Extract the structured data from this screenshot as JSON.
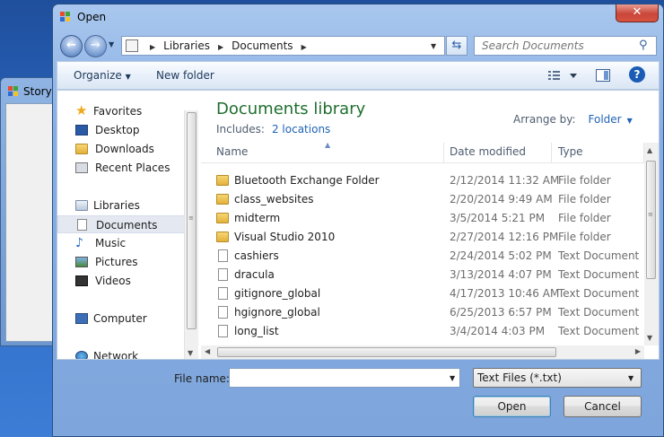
{
  "background_window": {
    "title": "Story"
  },
  "dialog": {
    "title": "Open",
    "close_glyph": "✕"
  },
  "address": {
    "crumbs": [
      "Libraries",
      "Documents"
    ],
    "search_placeholder": "Search Documents"
  },
  "toolbar": {
    "organize": "Organize",
    "new_folder": "New folder",
    "help": "?"
  },
  "nav": {
    "favorites": "Favorites",
    "favorite_items": [
      "Desktop",
      "Downloads",
      "Recent Places"
    ],
    "libraries": "Libraries",
    "library_items": [
      "Documents",
      "Music",
      "Pictures",
      "Videos"
    ],
    "selected": "Documents",
    "computer": "Computer",
    "network": "Network"
  },
  "library": {
    "title": "Documents library",
    "includes_label": "Includes:",
    "includes_link": "2 locations",
    "arrange_label": "Arrange by:",
    "arrange_value": "Folder"
  },
  "columns": {
    "name": "Name",
    "date": "Date modified",
    "type": "Type"
  },
  "files": [
    {
      "name": "Bluetooth Exchange Folder",
      "date": "2/12/2014 11:32 AM",
      "type": "File folder",
      "kind": "folder"
    },
    {
      "name": "class_websites",
      "date": "2/20/2014 9:49 AM",
      "type": "File folder",
      "kind": "folder"
    },
    {
      "name": "midterm",
      "date": "3/5/2014 5:21 PM",
      "type": "File folder",
      "kind": "folder"
    },
    {
      "name": "Visual Studio 2010",
      "date": "2/27/2014 12:16 PM",
      "type": "File folder",
      "kind": "folder"
    },
    {
      "name": "cashiers",
      "date": "2/24/2014 5:02 PM",
      "type": "Text Document",
      "kind": "doc"
    },
    {
      "name": "dracula",
      "date": "3/13/2014 4:07 PM",
      "type": "Text Document",
      "kind": "doc"
    },
    {
      "name": "gitignore_global",
      "date": "4/17/2013 10:46 AM",
      "type": "Text Document",
      "kind": "doc"
    },
    {
      "name": "hgignore_global",
      "date": "6/25/2013 6:57 PM",
      "type": "Text Document",
      "kind": "doc"
    },
    {
      "name": "long_list",
      "date": "3/4/2014 4:03 PM",
      "type": "Text Document",
      "kind": "doc"
    }
  ],
  "footer": {
    "file_name_label": "File name:",
    "file_name_value": "",
    "filter": "Text Files (*.txt)",
    "open": "Open",
    "cancel": "Cancel"
  }
}
